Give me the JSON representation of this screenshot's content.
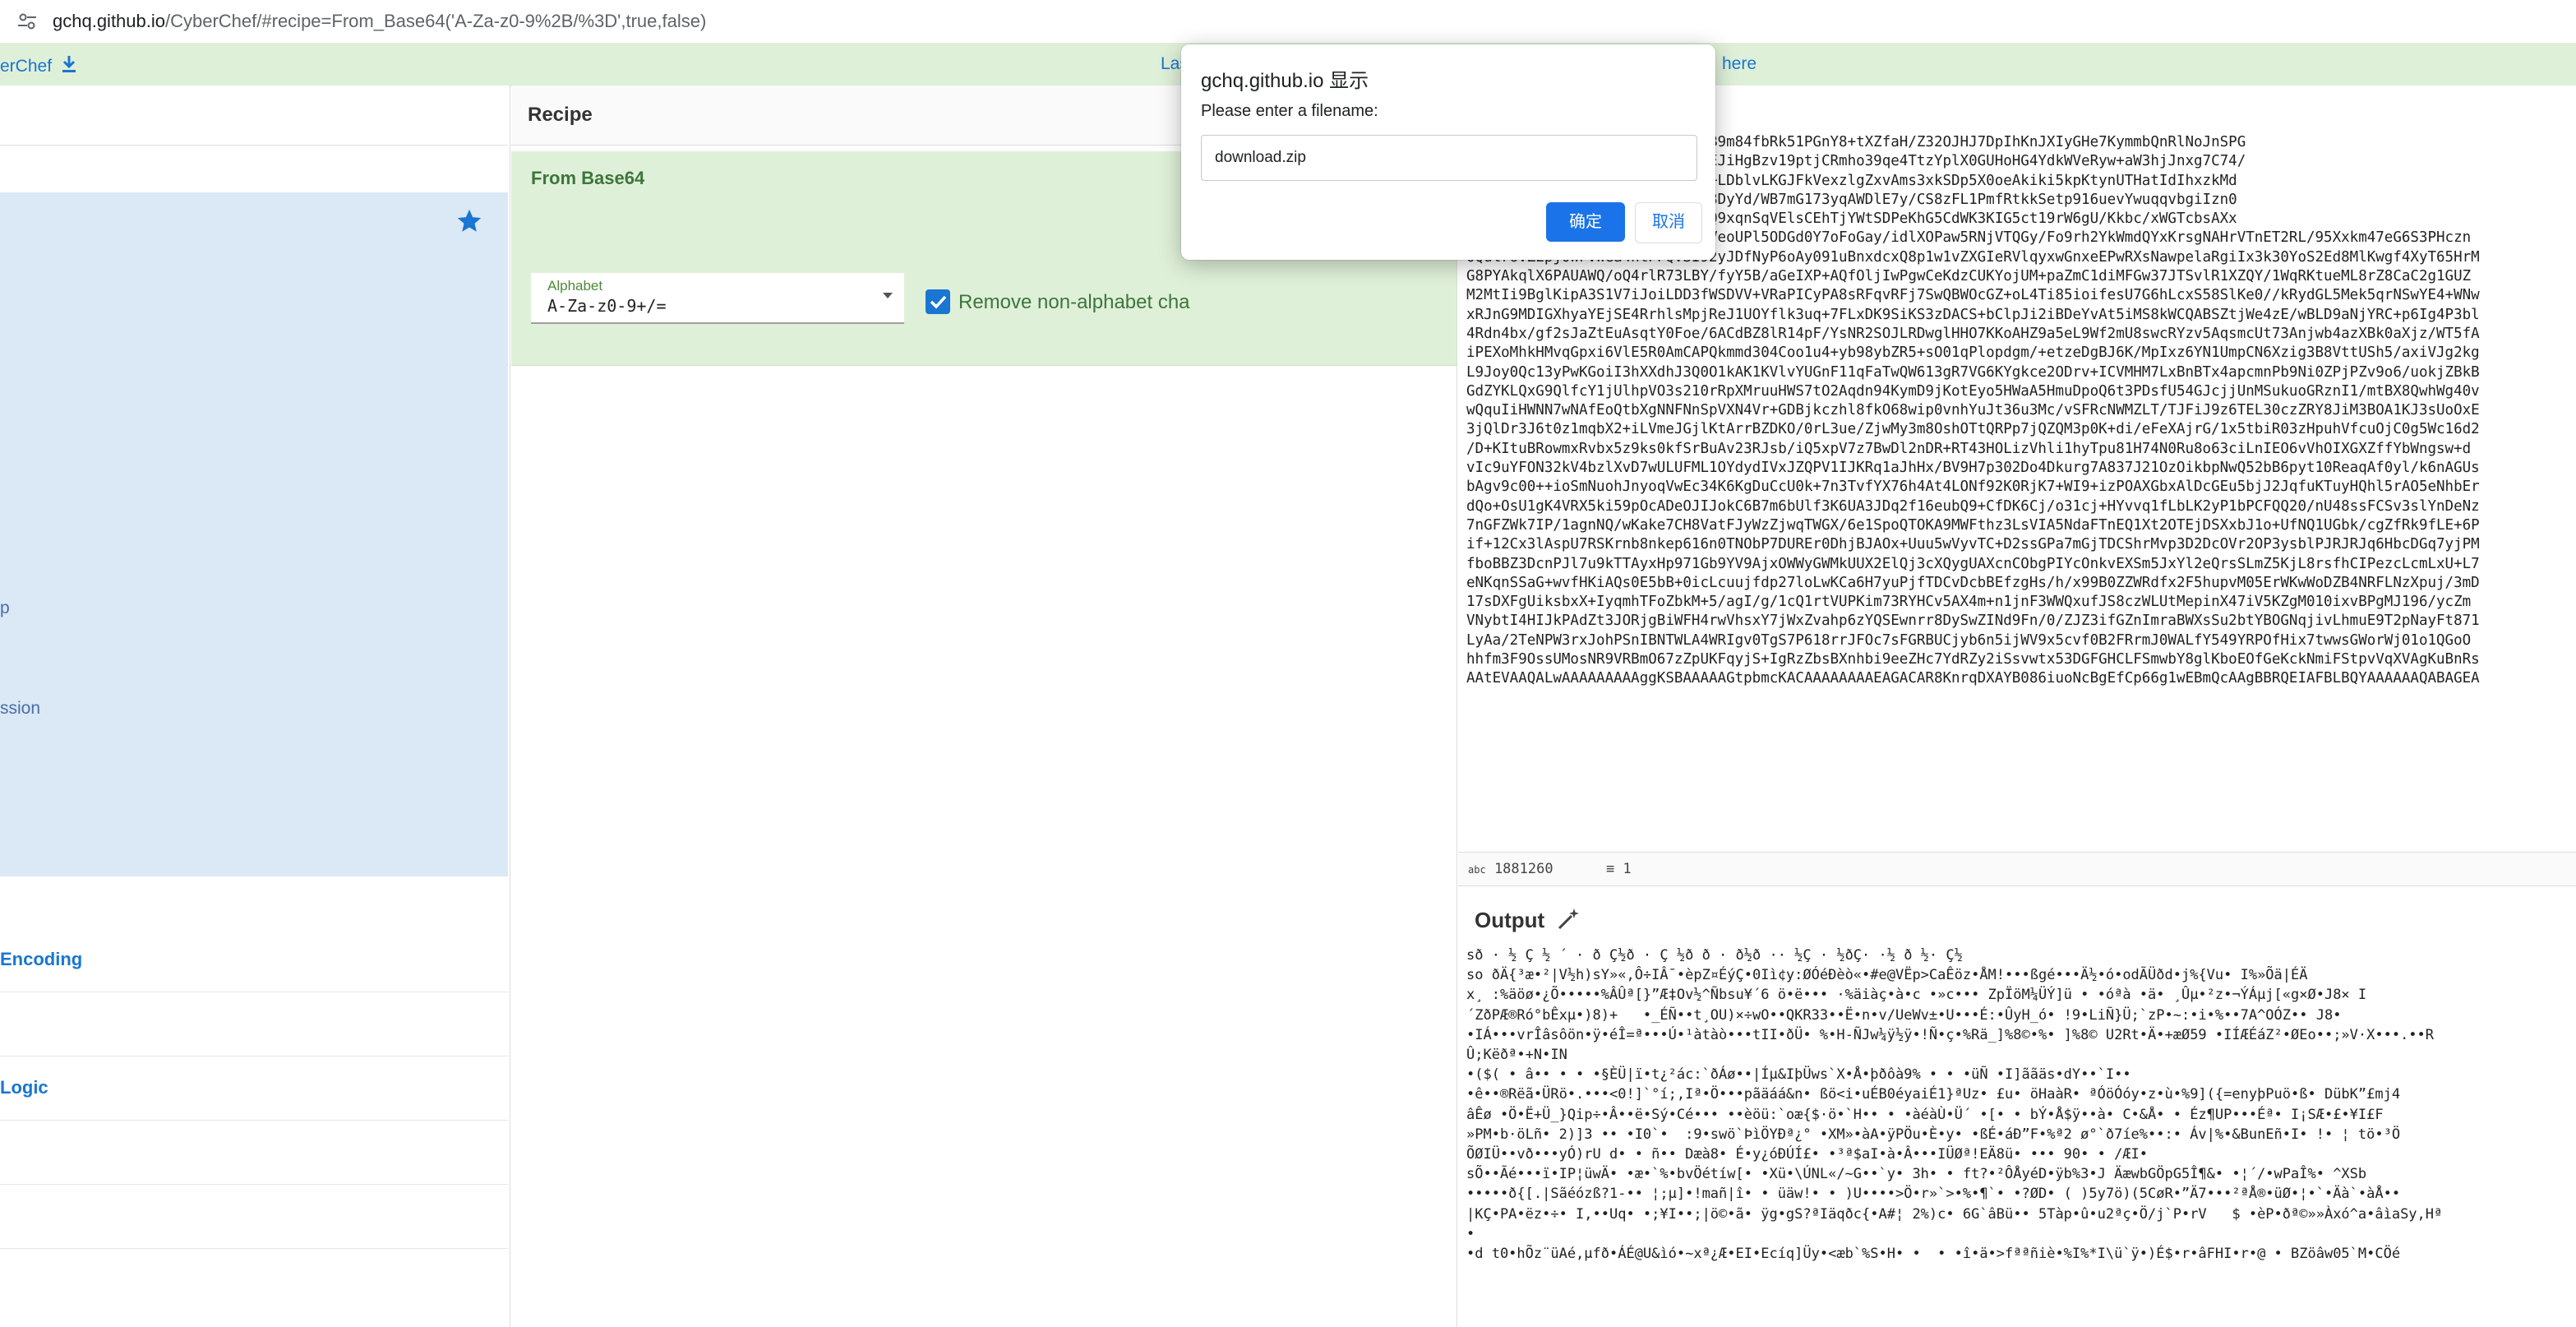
{
  "browser": {
    "url_host": "gchq.github.io",
    "url_rest": "/CyberChef/#recipe=From_Base64('A-Za-z0-9%2B/%3D',true,false)"
  },
  "banner": {
    "brand": "erChef",
    "last_build": "Las",
    "here_link": "here"
  },
  "ops": {
    "fav_items": [
      {
        "label": "p"
      },
      {
        "label": "ssion"
      }
    ],
    "categories": [
      {
        "label": "Encoding"
      },
      {
        "label": "Logic"
      }
    ]
  },
  "recipe": {
    "title": "Recipe",
    "operation": {
      "name": "From Base64",
      "alphabet_label": "Alphabet",
      "alphabet_value": "A-Za-z0-9+/=",
      "remove_label": "Remove non-alphabet cha"
    }
  },
  "input": {
    "lines": [
      "lImgpg+mwf2VD5GklrMA0yGsfWjbB9m84fbRk51PGnY8+tXZfaH/Z32OJHJ7DpIhKnJXIyGHe7KymmbQnRlNoJnSPG",
      "awdhf2rcfeKjH6i8cgstuCthy/GUEJiHgBzv19ptjCRmho39qe4TtzYplX0GUHoHG4YdkWVeRyw+aW3hjJnxg7C74/",
      "SWy4Nn/jeQZ8vSV2hPccUaYZH6Rp+LDblvLKGJFkVexzlgZxvAms3xkSDp5X0oeAkiki5kpKtynUTHatIdIhxzkMd",
      "JOIhjG2XMkzIhh/Q6aazw7wyWKsf8DyYd/WB7mG173yqAWDlE7y/CS8zFL1PmfRtkkSetp916uevYwuqqvbgiIzn0",
      "N21Gz7W8W3gl9abUjN88KuSSqRQiQ9xqnSqVElsCEhTjYWtSDPeKhG5CdWK3KIG5ct19rW6gU/Kkbc/xWGTcbsAXx",
      "TNOenvRCeXTW6G5n6KKR4Y9yNoPwVeoUPl5ODGd0Y7oFoGay/idlXOPaw5RNjVTQGy/Fo9rh2YkWmdQYxKrsgNAHrVTnET2RL/95Xxkm47eG6S3PHczn",
      "0QulroVZEpj0WFVWGa4ntPFQvSI92yJDfNyP6oAy091uBnxdcxQ8p1w1vZXGIeRVlqyxwGnxeEPwRXsNawpelaRgiIx3k30YoS2Ed8MlKwgf4XyT65HrM",
      "G8PYAkqlX6PAUAWQ/oQ4rlR73LBY/fyY5B/aGeIXP+AQfOljIwPgwCeKdzCUKYojUM+paZmC1diMFGw37JTSvlR1XZQY/1WqRKtueML8rZ8CaC2g1GUZ",
      "M2MtIi9BglKipA3S1V7iJoiLDD3fWSDVV+VRaPICyPA8sRFqvRFj7SwQBWOcGZ+oL4Ti85ioifesU7G6hLcxS58SlKe0//kRydGL5Mek5qrNSwYE4+WNw",
      "xRJnG9MDIGXhyaYEjSE4RrhlsMpjReJ1UOYflk3uq+7FLxDK9SiKS3zDACS+bClpJi2iBDeYvAt5iMS8kWCQABSZtjWe4zE/wBLD9aNjYRC+p6Ig4P3bl",
      "4Rdn4bx/gf2sJaZtEuAsqtY0Foe/6ACdBZ8lR14pF/YsNR2SOJLRDwglHHO7KKoAHZ9a5eL9Wf2mU8swcRYzv5AqsmcUt73Anjwb4azXBk0aXjz/WT5fA",
      "iPEXoMhkHMvqGpxi6VlE5R0AmCAPQkmmd304Coo1u4+yb98ybZR5+sO01qPlopdgm/+etzeDgBJ6K/MpIxz6YN1UmpCN6Xzig3B8VttUSh5/axiVJg2kg",
      "L9Joy0Qc13yPwKGoiI3hXXdhJ3Q0O1kAK1KVlvYUGnF11qFaTwQW613gR7VG6KYgkce2ODrv+ICVMHM7LxBnBTx4apcmnPb9Ni0ZPjPZv9o6/uokjZBkB",
      "GdZYKLQxG9QlfcY1jUlhpVO3s210rRpXMruuHWS7tO2Aqdn94KymD9jKotEyo5HWaA5HmuDpoQ6t3PDsfU54GJcjjUnMSukuoGRznI1/mtBX8QwhWg40v",
      "wQquIiHWNN7wNAfEoQtbXgNNFNnSpVXN4Vr+GDBjkczhl8fkO68wip0vnhYuJt36u3Mc/vSFRcNWMZLT/TJFiJ9z6TEL30czZRY8JiM3BOA1KJ3sUoOxE",
      "3jQlDr3J6t0z1mqbX2+iLVmeJGjlKtArrBZDKO/0rL3ue/ZjwMy3m8OshOTtQRPp7jQZQM3p0K+di/eFeXAjrG/1x5tbiR03zHpuhVfcuOjC0g5Wc16d2",
      "/D+KItuBRowmxRvbx5z9ks0kfSrBuAv23RJsb/iQ5xpV7z7BwDl2nDR+RT43HOLizVhli1hyTpu81H74N0Ru8o63ciLnIEO6vVhOIXGXZffYbWngsw+d",
      "vIc9uYFON32kV4bzlXvD7wULUFML1OYdydIVxJZQPV1IJKRq1aJhHx/BV9H7p302Do4Dkurg7A837J21OzOikbpNwQ52bB6pyt10ReaqAf0yl/k6nAGUs",
      "bAgv9c00++ioSmNuohJnyoqVwEc34K6KgDuCcU0k+7n3TvfYX76h4At4LONf92K0RjK7+WI9+izPOAXGbxAlDcGEu5bjJ2JqfuKTuyHQhl5rAO5eNhbEr",
      "dQo+OsU1gK4VRX5ki59pOcADeOJIJokC6B7m6bUlf3K6UA3JDq2f16eubQ9+CfDK6Cj/o31cj+HYvvq1fLbLK2yP1bPCFQQ20/nU48ssFCSv3slYnDeNz",
      "7nGFZWk7IP/1agnNQ/wKake7CH8VatFJyWzZjwqTWGX/6e1SpoQTOKA9MWFthz3LsVIA5NdaFTnEQ1Xt2OTEjDSXxbJ1o+UfNQ1UGbk/cgZfRk9fLE+6P",
      "if+12Cx3lAspU7RSKrnb8nkep616n0TNObP7DUREr0DhjBJAOx+Uuu5wVyvTC+D2ssGPa7mGjTDCShrMvp3D2DcOVr2OP3ysblPJRJRJq6HbcDGq7yjPM",
      "fboBBZ3DcnPJl7u9kTTAyxHp971Gb9YV9AjxOWWyGWMkUUX2ElQj3cXQygUAXcnCObgPIYcOnkvEXSm5JxYl2eQrsSLmZ5KjL8rsfhCIPezcLcmLxU+L7",
      "eNKqnSSaG+wvfHKiAQs0E5bB+0icLcuujfdp27loLwKCa6H7yuPjfTDCvDcbBEfzgHs/h/x99B0ZZWRdfx2F5hupvM05ErWKwWoDZB4NRFLNzXpuj/3mD",
      "17sDXFgUiksbxX+IyqmhTFoZbkM+5/agI/g/1cQ1rtVUPKim73RYHCv5AX4m+n1jnF3WWQxufJS8czWLUtMepinX47iV5KZgM010ixvBPgMJ196/ycZm",
      "VNybtI4HIJkPAdZt3JORjgBiWFH4rwVhsxY7jWxZvahp6zYQSEwnrr8DySwZINd9Fn/0/ZJZ3ifGZnImraBWXsSu2btYBOGNqjivLhmuE9T2pNayFt871",
      "LyAa/2TeNPW3rxJohPSnIBNTWLA4WRIgv0TgS7P618rrJFOc7sFGRBUCjyb6n5ijWV9x5cvf0B2FRrmJ0WALfY549YRPOfHix7twwsGWorWj01o1QGoO",
      "hhfm3F9OssUMosNR9VRBmO67zZpUKFqyjS+IgRzZbsBXnhbi9eeZHc7YdRZy2iSsvwtx53DGFGHCLFSmwbY8glKboEOfGeKckNmiFStpvVqXVAgKuBnRs",
      "AAtEVAAQALwAAAAAAAAAggKSBAAAAAGtpbmcKACAAAAAAAAEAGACAR8KnrqDXAYB086iuoNcBgEfCp66g1wEBmQcAAgBBRQEIAFBLBQYAAAAAAQABAGEA"
    ],
    "length": "1881260",
    "lines_count": "1"
  },
  "output": {
    "title": "Output",
    "lines": [
      "sð · ½ Ç ½ ´ · ð Ç½ð · Ç ½ð ð · ð½ð ·· ½Ç · ½ðÇ· ·½ ð ½· Ç½",
      "so ðÄ{³æ•²|V½h)sY»«,Ô÷IÂ¯•èpZ¤ÉýÇ•0Iì¢y:ØÓéÐèò«•#e@VËp>CaÊöz•ÅM!•••ßgé•••Ä½•ó•odÃÜðd•j%{Vu• I%»Õä|ÉÄ",
      "x¸ :%äöø•¿Õ•••••%ÂÛª[}”Æ‡Ov½^Ñbsu¥´6 ö•ë••• ·%äiàç•à•c •»c••• ZpÏöM¼ÜÝ]ü • •óªà •ä• ¸Ûµ•²z•¬ÝÁµj[«g×Ø•J8× I",
      "´ZðPÆ®Ró°bÊxµ•)8)+   •_ÉÑ••t¸OU)×÷wO••QKR33••Ë•n•v/UeWv±•U•••É:•ÛyH_ó• !9•LiÑ}Ü;`zP•~:•i•%••7A^OÓZ•• J8•",
      "•IÁ•••vrÎâsôön•ÿ•éÎ=ª•••Ú•¹àtàò•••tII•ðÜ• %•H-ÑJw¼ÿ½ÿ•!Ñ•ç•%Rä_]%8©•%• ]%8© U2Rt•Ä•+æØ59 •IÍÆÉáZ²•ØEo••;»V·X•••.••R",
      "Û;Këðª•+N•IN",
      "•($( • â•• • • •§ÈÜ|ï•t¿²ác:`ðÁø••|Íµ&IþÜws`X•Å•þðôà9% • • •üÑ •I]ããäs•dY••`I••",
      "•ê••®Rëã•ÜRö•.•••<0!]`°í;,Iª•Ö•••pãäáá&n• ßö<i•uÉB0éyaiÉ1}ªUz• £u• öHaàR• ªÓöÓóy•z•ù•%9]({=enyþPuö•ß• DübK”£mj4",
      "âÊø •Ö•Ë+Ü_}Qip÷•Â••ë•Sý•Cé••• ••èöü:`oæ{$·ö•`H•• • •àéàÙ•Ü´ •[• • bÝ•Å$ÿ••à• C•&Å• • Éz¶UP•••Éª• I¡SÆ•£•¥I£F",
      "»PM•b·öLñ• 2)]3 •• •I0`•  :9•swö`ÞìÖYÐª¿° •XM»•àA•ÿPÖu•È•y• •ßÉ•áÐ”F•%ª2 ø°`ð7íe%••:• Áv|%•&BunEñ•I• !• ¦ tö•³Ö",
      "ÕØIÜ••vð•••yÓ)rU d• • ñ•• Dæà8• É•y¿óÐÚÍ£• •³ª$aI•à•Â•••IÜØª!EÄ8ü• ••• 90• • /ÆI•",
      "sÕ••Ãé•••ï•IP¦üwÄ• •æ•`%•bvÖétíw[• •Xü•\\ÚNL«/~G••`y• 3h• • ft?•²ÔÅyéD•ÿb%3•J ÄæwbGÖpG5Î¶&• •¦´/•wPaÎ%• ^XSb",
      "•••••ð{[.|Sãéózß?1-•• ¦;µ]•!mañ|î• • üäw!• • )U••••>Ö•r»`>•%•¶`• •?ØD• ( )5y7ö)(5CøR•”Ä7•••²ªÅ®•üØ•¦•`•Äà`•àÅ••",
      "|KÇ•PA•ëz•÷• I,••Uq• •;¥I••;|ö©•ã• ÿg•gS?ªIäqðc{•A#¦ 2%)c• 6G`âBü•• 5Tàp•û•u2ªç•Ö/j`P•rV   $ •èP•ðª©»»Àxó^a•âìaSy,Hª",
      "•",
      "•d t0•hÕz¨üAé,µfð•ÁÉ@U&ìó•~xª¿Æ•EI•Ecíq]Üy•<æb`%S•H• •  • •î•ä•>fªªñiè•%I%*I\\ü`ÿ•)É$•r•âFHI•r•@ • BZöâw05`M•CÖé"
    ]
  },
  "dialog": {
    "title": "gchq.github.io 显示",
    "prompt": "Please enter a filename:",
    "filename": "download.zip",
    "ok_label": "确定",
    "cancel_label": "取消"
  }
}
